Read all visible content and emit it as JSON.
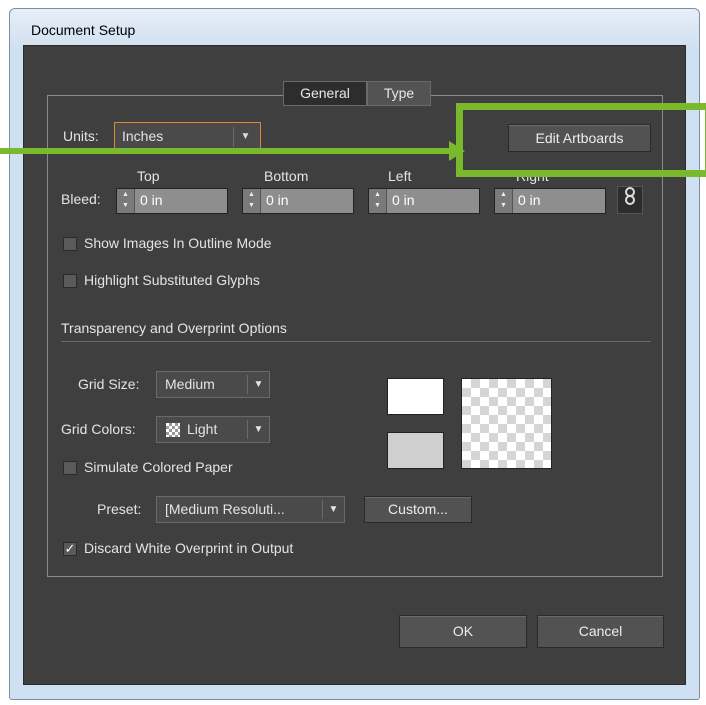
{
  "window": {
    "title": "Document Setup"
  },
  "tabs": [
    {
      "label": "General"
    },
    {
      "label": "Type"
    }
  ],
  "units": {
    "label": "Units:",
    "value": "Inches"
  },
  "edit_artboards_label": "Edit Artboards",
  "bleed": {
    "label": "Bleed:",
    "fields": [
      {
        "header": "Top",
        "value": "0 in"
      },
      {
        "header": "Bottom",
        "value": "0 in"
      },
      {
        "header": "Left",
        "value": "0 in"
      },
      {
        "header": "Right",
        "value": "0 in"
      }
    ]
  },
  "options": [
    {
      "label": "Show Images In Outline Mode",
      "checked": false
    },
    {
      "label": "Highlight Substituted Glyphs",
      "checked": false
    }
  ],
  "transparency": {
    "heading": "Transparency and Overprint Options",
    "grid_size_label": "Grid Size:",
    "grid_size_value": "Medium",
    "grid_colors_label": "Grid Colors:",
    "grid_colors_value": "Light",
    "simulate_paper_label": "Simulate Colored Paper",
    "simulate_paper_checked": false,
    "preset_label": "Preset:",
    "preset_value": "[Medium Resoluti...",
    "custom_label": "Custom...",
    "discard_label": "Discard White Overprint in Output",
    "discard_checked": true
  },
  "buttons": {
    "ok": "OK",
    "cancel": "Cancel"
  },
  "icons": {
    "checkmark": "✓",
    "dropdown_arrow": "▼",
    "spinner_up": "▲",
    "spinner_down": "▼",
    "link": "chain-link-icon"
  },
  "colors": {
    "annotation": "#7ab82c",
    "focus": "#e0862c",
    "dialog_bg": "#3f3f3f"
  }
}
